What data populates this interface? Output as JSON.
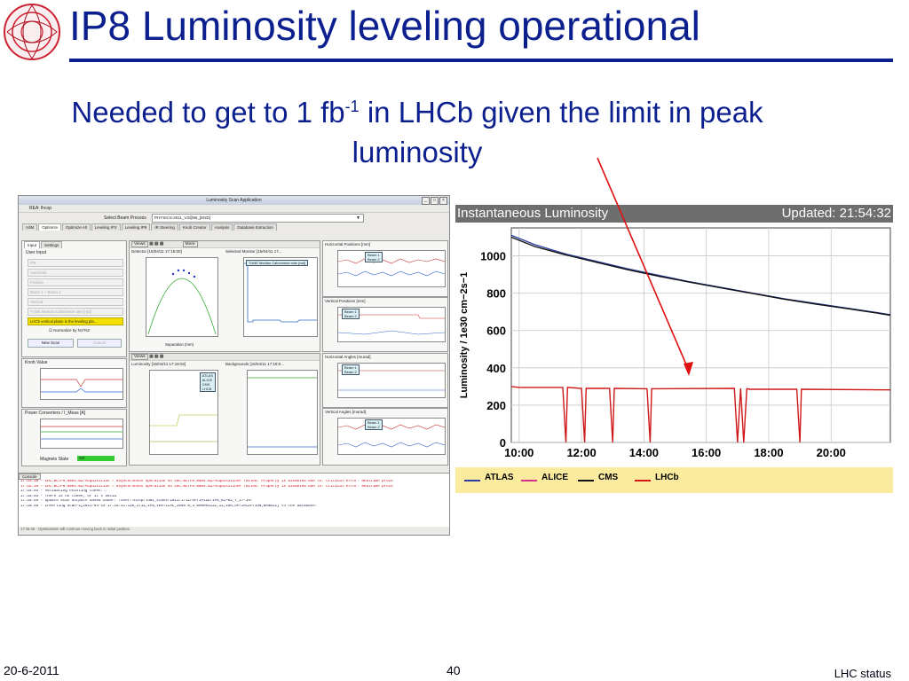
{
  "slide": {
    "title": "IP8 Luminosity leveling operational",
    "subtitle_pre": "Needed to get to 1 fb",
    "subtitle_sup": "-1",
    "subtitle_post": " in LHCb given the limit in peak luminosity",
    "footer_date": "20-6-2011",
    "footer_page": "40",
    "footer_right": "LHC status",
    "logo_icon": "lhc-logo-icon",
    "annotation": "red-arrow"
  },
  "app": {
    "window_title": "Luminosity Scan Application",
    "menu": "REA: lhcop",
    "beam_process_label": "Select Beam Process",
    "beam_process_value": "PHYSICS-2011_V3@56_[END]",
    "tabs": [
      "VdM",
      "Optimize",
      "Optimize All",
      "Leveling IP2",
      "Leveling IP8",
      "IR Steering",
      "Knob Creator",
      "Analysis",
      "Database Extraction"
    ],
    "input_tabs": [
      "Input",
      "Settings"
    ],
    "user_input_label": "User Input",
    "fields": [
      "IP8",
      "Automatic",
      "Position",
      "Beam 1 + Beam 2",
      "Vertical",
      "TUNE Median Calorimeter rate [rad]"
    ],
    "status_field": "LHCb vertical plane is the leveling pla...",
    "normalize_label": "Normalize by N1*N2",
    "new_scan_button": "New Scan",
    "cancel_button": "Cancel",
    "knob_value_label": "Knob Value",
    "power_converters_label": "Power Converters / I_Meas [A]",
    "magnets_state_label": "Magnets State",
    "magnets_state_value": "OK",
    "views_label": "Views",
    "more_label": "More",
    "detector_title": "Detector [15/04/11 17:15:00]",
    "selected_monitor_title": "Selected Monitor [15/04/11 17...",
    "monitor_legend": "TUNE Median Calorimeter rate [rad]",
    "separation_label": "Separation (mm)",
    "luminosity_title": "Luminosity [15/04/11 17:18:02]",
    "backgrounds_title": "Backgrounds [15/04/11 17:18:0...",
    "lumi_legend": [
      "ATLAS",
      "ALICE",
      "CMS",
      "LHCB"
    ],
    "h_positions_title": "Horizontal Positions [mm]",
    "v_positions_title": "Vertical Positions [mm]",
    "h_angles_title": "Horizontal Angles [murad]",
    "v_angles_title": "Vertical Angles [murad]",
    "beam_legend": [
      "Beam 1",
      "Beam 2"
    ],
    "console_tab": "Console",
    "console_lines": [
      {
        "t": "17:15:10 - LHC.BCTFR.08R4.B2/Acquisition / asynchronous operation on LHC.BCTFR.08R4.B2/Acquisition# failed:  Property is disabled due to: Critical error: RealTime proce",
        "err": true
      },
      {
        "t": "17:15:10 - LHC.BCTFR.08R4.B2/Acquisition / asynchronous operation on LHC.BCTFR.08R4.B2/Acquisition# failed:  Property is disabled due to: Critical error: RealTime proce",
        "err": true
      },
      {
        "t": "17:18:03 - Validating existing token...",
        "err": false
      },
      {
        "t": "17:18:03 - There is no token, or it's valid",
        "err": false
      },
      {
        "t": "17:18:56 - Update Scan Outputs Saved Under: /user/lhcop/lumi_scans/2011/1712/OPTIMIZE/IP8_B1+B2_Y_17-15/",
        "err": false
      },
      {
        "t": "17:18:56 - Inserting Scan-1[2011-04-15 17:15:41.126,1712,IP8,VERTICAL,3500.0,3.000001122,12,180,OPTIMIZATION,Beam12] to the database.",
        "err": false
      }
    ],
    "status_bar": "17:18:45 - Optimization will continue moving back to initial position."
  },
  "monitor": {
    "title": "Instantaneous Luminosity",
    "updated": "Updated: 21:54:32",
    "legend": [
      {
        "name": "ATLAS",
        "color": "#2a3ea0"
      },
      {
        "name": "ALICE",
        "color": "#d0308c"
      },
      {
        "name": "CMS",
        "color": "#111111"
      },
      {
        "name": "LHCb",
        "color": "#d01818"
      }
    ]
  },
  "chart_data": {
    "type": "line",
    "title": "Instantaneous Luminosity",
    "ylabel": "Luminosity / 1e30 cm−2s−1",
    "xlabel": "",
    "x_ticks": [
      "10:00",
      "12:00",
      "14:00",
      "16:00",
      "18:00",
      "20:00"
    ],
    "y_ticks": [
      0,
      200,
      400,
      600,
      800,
      1000
    ],
    "xlim": [
      9.75,
      21.9
    ],
    "ylim": [
      0,
      1150
    ],
    "grid": true,
    "series": [
      {
        "name": "ATLAS",
        "color": "#2a3ea0",
        "x": [
          9.75,
          10.5,
          11.5,
          12.5,
          13.5,
          14.5,
          15.5,
          16.5,
          17.5,
          18.5,
          19.5,
          20.5,
          21.5,
          21.9
        ],
        "values": [
          1110,
          1060,
          1010,
          970,
          930,
          895,
          860,
          830,
          800,
          770,
          745,
          720,
          695,
          685
        ]
      },
      {
        "name": "CMS",
        "color": "#111111",
        "x": [
          9.75,
          10.5,
          11.5,
          12.5,
          13.5,
          14.5,
          15.5,
          16.5,
          17.5,
          18.5,
          19.5,
          20.5,
          21.5,
          21.9
        ],
        "values": [
          1100,
          1050,
          1005,
          965,
          925,
          890,
          858,
          828,
          798,
          768,
          742,
          718,
          693,
          682
        ]
      },
      {
        "name": "LHCb",
        "color": "#d01818",
        "x": [
          9.75,
          10.0,
          11.4,
          11.5,
          11.55,
          12.0,
          12.1,
          12.15,
          12.9,
          13.0,
          13.05,
          14.1,
          14.2,
          14.25,
          16.9,
          17.0,
          17.1,
          17.2,
          17.3,
          17.4,
          18.9,
          19.0,
          19.05,
          21.9
        ],
        "values": [
          300,
          295,
          295,
          0,
          295,
          290,
          0,
          290,
          290,
          0,
          290,
          288,
          0,
          288,
          290,
          0,
          290,
          0,
          288,
          285,
          285,
          0,
          285,
          282
        ]
      }
    ]
  }
}
